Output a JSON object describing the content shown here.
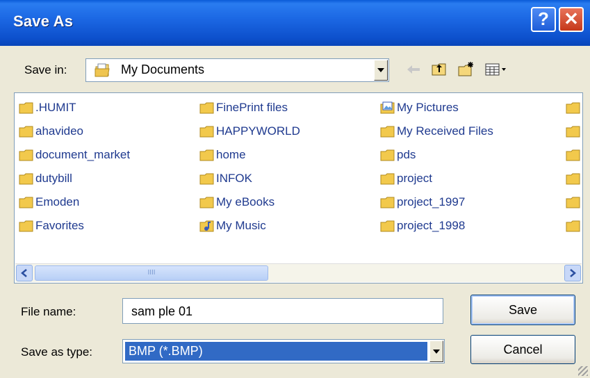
{
  "dialog": {
    "title": "Save As",
    "help_label": "?",
    "close_label": "✕"
  },
  "save_in": {
    "label": "Save in:",
    "value": "My Documents"
  },
  "toolbar": {
    "icons": [
      "back-arrow-icon",
      "up-folder-icon",
      "new-folder-icon",
      "view-menu-icon"
    ]
  },
  "files": {
    "col1": [
      ".HUMIT",
      "ahavideo",
      "document_market",
      "dutybill",
      "Emoden",
      "Favorites"
    ],
    "col2": [
      "FinePrint files",
      "HAPPYWORLD",
      "home",
      "INFOK",
      "My eBooks",
      "My Music"
    ],
    "col3": [
      "My Pictures",
      "My Received Files",
      "pds",
      "project",
      "project_1997",
      "project_1998"
    ]
  },
  "scrollbar": {
    "thumb_grip": "IIII"
  },
  "filename": {
    "label": "File name:",
    "value": "sam ple 01"
  },
  "filetype": {
    "label": "Save as type:",
    "value": "BMP (*.BMP)"
  },
  "buttons": {
    "save": "Save",
    "cancel": "Cancel"
  },
  "colors": {
    "titlebar": "#0C4FCB",
    "selection": "#316AC5",
    "folder": "#F2C94C"
  }
}
